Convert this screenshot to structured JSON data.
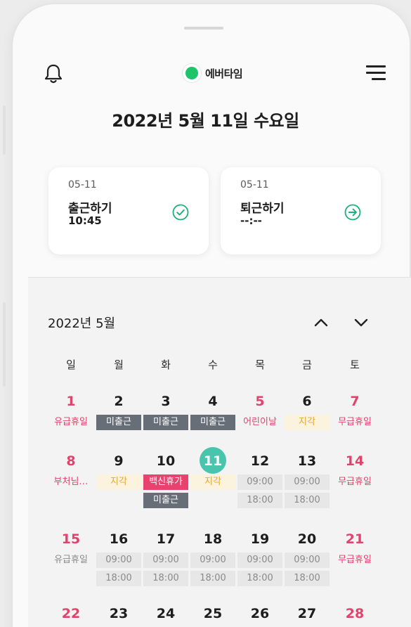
{
  "header": {
    "brand_name": "에버타임"
  },
  "date_title": "2022년 5월 11일 수요일",
  "checkin": {
    "date": "05-11",
    "title": "출근하기",
    "time": "10:45"
  },
  "checkout": {
    "date": "05-11",
    "title": "퇴근하기",
    "time": "--:--"
  },
  "calendar": {
    "month_label": "2022년  5월",
    "weekdays": [
      "일",
      "월",
      "화",
      "수",
      "목",
      "금",
      "토"
    ],
    "weeks": [
      {
        "days": [
          "1",
          "2",
          "3",
          "4",
          "5",
          "6",
          "7"
        ],
        "badges": [
          [
            "유급휴일"
          ],
          [
            "미출근"
          ],
          [
            "미출근"
          ],
          [
            "미출근"
          ],
          [
            "어린이날"
          ],
          [
            "지각"
          ],
          [
            "무급휴일"
          ]
        ]
      },
      {
        "days": [
          "8",
          "9",
          "10",
          "11",
          "12",
          "13",
          "14"
        ],
        "badges": [
          [
            "부처님…"
          ],
          [
            "지각"
          ],
          [
            "백신휴가",
            "미출근"
          ],
          [
            "지각"
          ],
          [
            "09:00",
            "18:00"
          ],
          [
            "09:00",
            "18:00"
          ],
          [
            "무급휴일"
          ]
        ]
      },
      {
        "days": [
          "15",
          "16",
          "17",
          "18",
          "19",
          "20",
          "21"
        ],
        "badges": [
          [
            "유급휴일"
          ],
          [
            "09:00",
            "18:00"
          ],
          [
            "09:00",
            "18:00"
          ],
          [
            "09:00",
            "18:00"
          ],
          [
            "09:00",
            "18:00"
          ],
          [
            "09:00",
            "18:00"
          ],
          [
            "무급휴일"
          ]
        ]
      },
      {
        "days": [
          "22",
          "23",
          "24",
          "25",
          "26",
          "27",
          "28"
        ],
        "badges": [
          [],
          [],
          [],
          [],
          [],
          [],
          []
        ]
      }
    ],
    "today": "11"
  },
  "colors": {
    "brand": "#1ec46a",
    "accent": "#49c4ad",
    "holiday_red": "#e0436b",
    "absent_gray": "#686e78",
    "late_yellow": "#e6a730"
  },
  "icons": [
    "bell-icon",
    "menu-icon",
    "check-circle-icon",
    "arrow-right-circle-icon",
    "chevron-up-icon",
    "chevron-down-icon"
  ]
}
